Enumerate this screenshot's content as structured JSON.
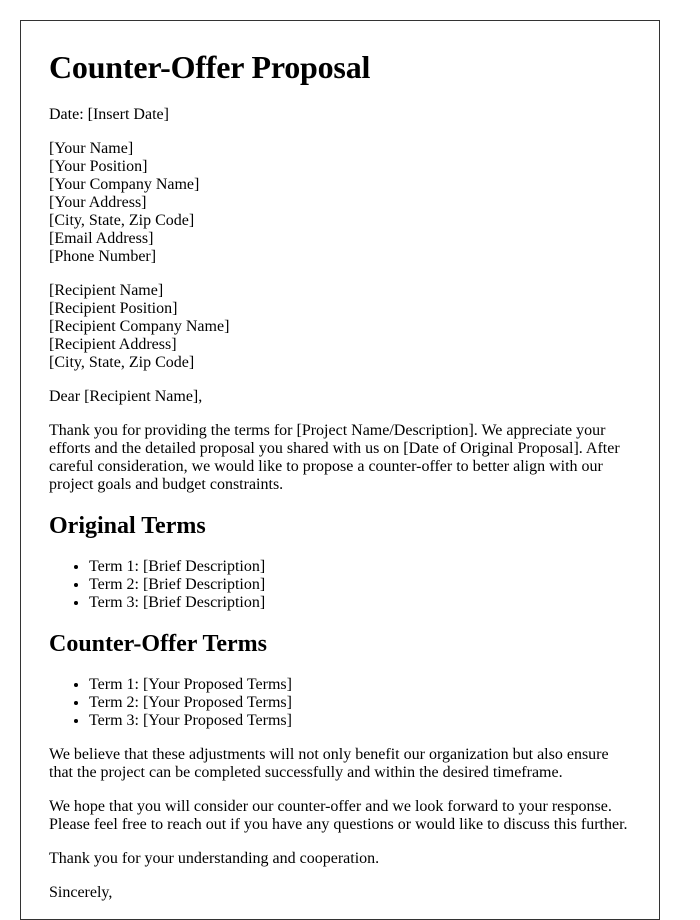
{
  "document": {
    "title": "Counter-Offer Proposal",
    "date_line": "Date: [Insert Date]",
    "sender": [
      "[Your Name]",
      "[Your Position]",
      "[Your Company Name]",
      "[Your Address]",
      "[City, State, Zip Code]",
      "[Email Address]",
      "[Phone Number]"
    ],
    "recipient": [
      "[Recipient Name]",
      "[Recipient Position]",
      "[Recipient Company Name]",
      "[Recipient Address]",
      "[City, State, Zip Code]"
    ],
    "salutation": "Dear [Recipient Name],",
    "intro_paragraph": "Thank you for providing the terms for [Project Name/Description]. We appreciate your efforts and the detailed proposal you shared with us on [Date of Original Proposal]. After careful consideration, we would like to propose a counter-offer to better align with our project goals and budget constraints.",
    "original_terms": {
      "heading": "Original Terms",
      "items": [
        "Term 1: [Brief Description]",
        "Term 2: [Brief Description]",
        "Term 3: [Brief Description]"
      ]
    },
    "counter_terms": {
      "heading": "Counter-Offer Terms",
      "items": [
        "Term 1: [Your Proposed Terms]",
        "Term 2: [Your Proposed Terms]",
        "Term 3: [Your Proposed Terms]"
      ]
    },
    "benefit_paragraph": "We believe that these adjustments will not only benefit our organization but also ensure that the project can be completed successfully and within the desired timeframe.",
    "closing_paragraph": "We hope that you will consider our counter-offer and we look forward to your response. Please feel free to reach out if you have any questions or would like to discuss this further.",
    "thanks_paragraph": "Thank you for your understanding and cooperation.",
    "signoff": "Sincerely,"
  }
}
